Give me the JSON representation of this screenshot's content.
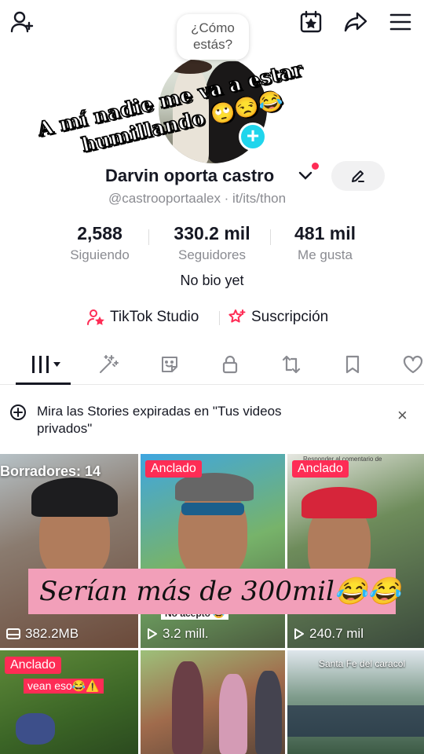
{
  "bubble": {
    "text_line1": "¿Cómo",
    "text_line2": "estás?"
  },
  "overlay_caption": {
    "line1": "A mí nadie me va a estar",
    "line2": "humillando 🙄😒😂"
  },
  "profile": {
    "name": "Darvin oporta castro",
    "handle_line": "@castrooportaalex · it/its/thon",
    "bio": "No bio yet"
  },
  "stats": [
    {
      "value": "2,588",
      "label": "Siguiendo"
    },
    {
      "value": "330.2 mil",
      "label": "Seguidores"
    },
    {
      "value": "481 mil",
      "label": "Me gusta"
    }
  ],
  "links": {
    "studio": "TikTok Studio",
    "subscription": "Suscripción"
  },
  "notice": {
    "text": "Mira las Stories expiradas en \"Tus videos privados\"",
    "close": "×"
  },
  "videos": [
    {
      "drafts_label": "Borradores: 14",
      "size": "382.2MB"
    },
    {
      "badge": "Anclado",
      "sticker": "No acepto 😂",
      "views": "3.2 mill."
    },
    {
      "badge": "Anclado",
      "header_text": "Responder al comentario de",
      "views": "240.7 mil"
    },
    {
      "badge": "Anclado",
      "sticker": "vean eso😂⚠️"
    },
    {},
    {
      "place_text": "Santa Fe del caracol"
    }
  ],
  "overlay_banner": "Serían más de 300mil😂😂",
  "colors": {
    "accent": "#fe2c55",
    "teal": "#20d5ec",
    "banner": "#f29fb9"
  }
}
